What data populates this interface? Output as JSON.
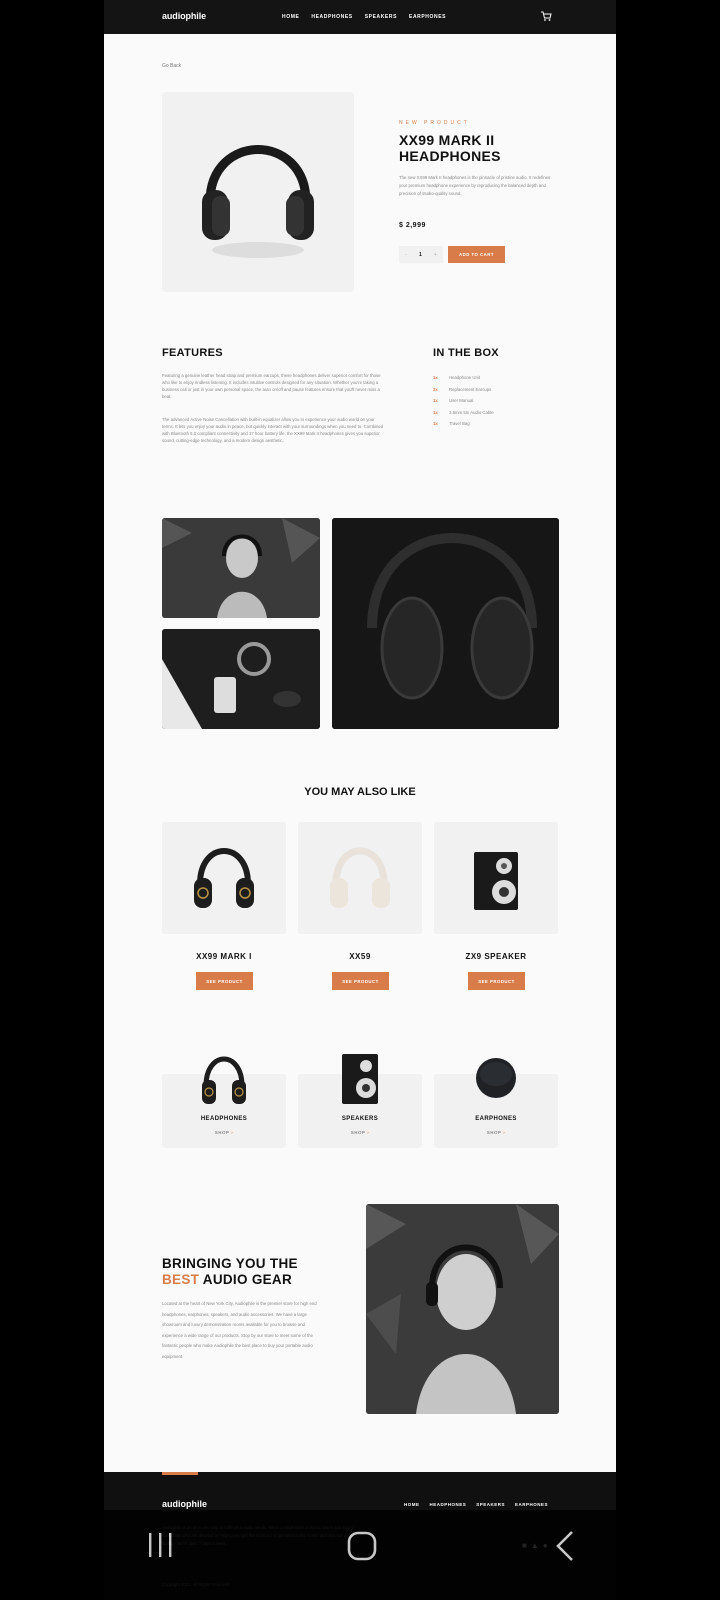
{
  "header": {
    "logo": "audiophile",
    "nav": [
      "HOME",
      "HEADPHONES",
      "SPEAKERS",
      "EARPHONES"
    ],
    "cart_icon": "cart-icon"
  },
  "product": {
    "go_back": "Go Back",
    "eyebrow": "NEW PRODUCT",
    "title": "XX99 MARK II HEADPHONES",
    "description": "The new XX99 Mark II headphones is the pinnacle of pristine audio. It redefines your premium headphone experience by reproducing the balanced depth and precision of studio-quality sound.",
    "price": "$ 2,999",
    "quantity": "1",
    "qty_minus": "-",
    "qty_plus": "+",
    "add_to_cart": "ADD TO CART"
  },
  "features": {
    "title": "FEATURES",
    "para1": "Featuring a genuine leather head strap and premium earcups, these headphones deliver superior comfort for those who like to enjoy endless listening. It includes intuitive controls designed for any situation. Whether you're taking a business call or just in your own personal space, the auto on/off and pause features ensure that you'll never miss a beat.",
    "para2": "The advanced Active Noise Cancellation with built-in equalizer allow you to experience your audio world on your terms. It lets you enjoy your audio in peace, but quickly interact with your surroundings when you need to. Combined with Bluetooth 5.0 compliant connectivity and 17 hour battery life, the XX99 Mark II headphones gives you superior sound, cutting-edge technology, and a modern design aesthetic."
  },
  "in_the_box": {
    "title": "IN THE BOX",
    "items": [
      {
        "qty": "1x",
        "name": "Headphone Unit"
      },
      {
        "qty": "2x",
        "name": "Replacement Earcups"
      },
      {
        "qty": "1x",
        "name": "User Manual"
      },
      {
        "qty": "1x",
        "name": "3.5mm 5m Audio Cable"
      },
      {
        "qty": "1x",
        "name": "Travel Bag"
      }
    ]
  },
  "also_like": {
    "title": "YOU MAY ALSO LIKE",
    "items": [
      {
        "name": "XX99 MARK I",
        "button": "SEE PRODUCT"
      },
      {
        "name": "XX59",
        "button": "SEE PRODUCT"
      },
      {
        "name": "ZX9 SPEAKER",
        "button": "SEE PRODUCT"
      }
    ]
  },
  "categories": [
    {
      "name": "HEADPHONES",
      "shop": "SHOP"
    },
    {
      "name": "SPEAKERS",
      "shop": "SHOP"
    },
    {
      "name": "EARPHONES",
      "shop": "SHOP"
    }
  ],
  "about": {
    "title_pre": "BRINGING YOU THE",
    "title_accent": "BEST",
    "title_post": "AUDIO GEAR",
    "text": "Located at the heart of New York City, Audiophile is the premier store for high end headphones, earphones, speakers, and audio accessories. We have a large showroom and luxury demonstration rooms available for you to browse and experience a wide range of our products. Stop by our store to meet some of the fantastic people who make Audiophile the best place to buy your portable audio equipment."
  },
  "footer": {
    "logo": "audiophile",
    "nav": [
      "HOME",
      "HEADPHONES",
      "SPEAKERS",
      "EARPHONES"
    ],
    "text": "Audiophile is an all in one stop to fulfill your audio needs. We're a small team of music lovers and sound specialists who are devoted to helping you get the most out of personal audio. Come and visit our demo facility - we're open 7 days a week.",
    "copyright": "Copyright 2021. All Rights Reserved"
  },
  "colors": {
    "accent": "#d87d4a",
    "dark": "#101010",
    "light": "#f1f1f1"
  }
}
